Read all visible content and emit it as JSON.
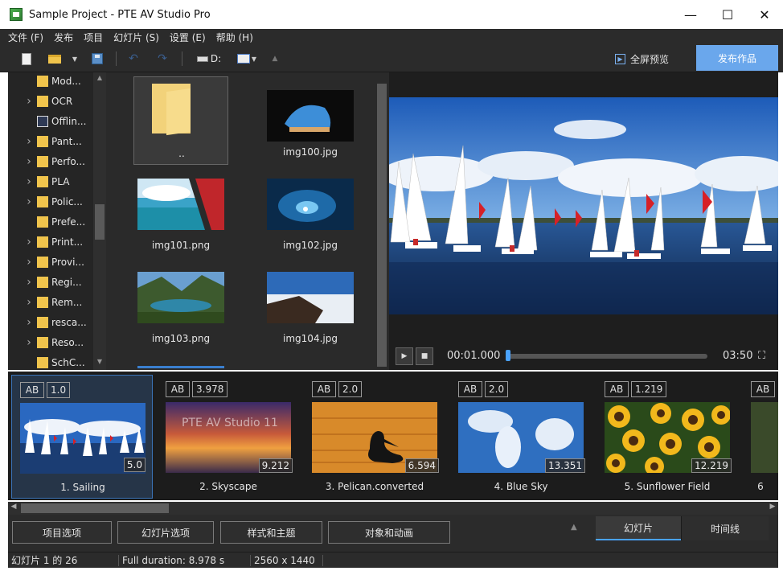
{
  "window": {
    "title": "Sample Project - PTE AV Studio Pro",
    "controls": {
      "minimize": "—",
      "maximize": "☐",
      "close": "✕"
    }
  },
  "menu": [
    "文件 (F)",
    "发布",
    "项目",
    "幻灯片 (S)",
    "设置 (E)",
    "帮助 (H)"
  ],
  "toolbar": {
    "drive_label": "D:",
    "fullscreen_preview": "全屏预览",
    "publish": "发布作品"
  },
  "tree": {
    "items": [
      {
        "label": "Mod...",
        "expandable": false,
        "icon": "folder-icon"
      },
      {
        "label": "OCR",
        "expandable": true,
        "icon": "folder-icon"
      },
      {
        "label": "Offlin...",
        "expandable": false,
        "icon": "special-folder-icon"
      },
      {
        "label": "Pant...",
        "expandable": true,
        "icon": "folder-icon"
      },
      {
        "label": "Perfo...",
        "expandable": true,
        "icon": "folder-icon"
      },
      {
        "label": "PLA",
        "expandable": true,
        "icon": "folder-icon"
      },
      {
        "label": "Polic...",
        "expandable": true,
        "icon": "folder-icon"
      },
      {
        "label": "Prefe...",
        "expandable": false,
        "icon": "folder-icon"
      },
      {
        "label": "Print...",
        "expandable": true,
        "icon": "folder-icon"
      },
      {
        "label": "Provi...",
        "expandable": true,
        "icon": "folder-icon"
      },
      {
        "label": "Regi...",
        "expandable": true,
        "icon": "folder-icon"
      },
      {
        "label": "Rem...",
        "expandable": true,
        "icon": "folder-icon"
      },
      {
        "label": "resca...",
        "expandable": true,
        "icon": "folder-icon"
      },
      {
        "label": "Reso...",
        "expandable": true,
        "icon": "folder-icon"
      },
      {
        "label": "SchC...",
        "expandable": false,
        "icon": "folder-icon"
      }
    ]
  },
  "files": [
    {
      "name": "..",
      "kind": "parent-folder"
    },
    {
      "name": "img100.jpg",
      "kind": "image"
    },
    {
      "name": "img101.png",
      "kind": "image"
    },
    {
      "name": "img102.jpg",
      "kind": "image"
    },
    {
      "name": "img103.png",
      "kind": "image"
    },
    {
      "name": "img104.jpg",
      "kind": "image"
    }
  ],
  "player": {
    "current_time": "00:01.000",
    "total_time": "03:50",
    "progress": 0.004
  },
  "slides": [
    {
      "name": "1. Sailing",
      "ab": "AB",
      "transition": "1.0",
      "duration": "5.0",
      "selected": true
    },
    {
      "name": "2. Skyscape",
      "ab": "AB",
      "transition": "3.978",
      "duration": "9.212",
      "selected": false,
      "overlay_text": "PTE AV Studio 11"
    },
    {
      "name": "3. Pelican.converted",
      "ab": "AB",
      "transition": "2.0",
      "duration": "6.594",
      "selected": false
    },
    {
      "name": "4. Blue Sky",
      "ab": "AB",
      "transition": "2.0",
      "duration": "13.351",
      "selected": false
    },
    {
      "name": "5. Sunflower Field",
      "ab": "AB",
      "transition": "1.219",
      "duration": "12.219",
      "selected": false
    },
    {
      "name": "6",
      "ab": "AB",
      "transition": "",
      "duration": "",
      "selected": false
    }
  ],
  "bottom_buttons": {
    "project_options": "项目选项",
    "slide_options": "幻灯片选项",
    "styles_themes": "样式和主题",
    "objects_animation": "对象和动画"
  },
  "view_tabs": {
    "slides": "幻灯片",
    "timeline": "时间线"
  },
  "status": {
    "slide_position": "幻灯片 1 的 26",
    "full_duration": "Full duration: 8.978 s",
    "resolution": "2560 x 1440"
  },
  "colors": {
    "accent": "#4aa3ff",
    "publish_bg": "#6aa7ec",
    "panel_bg": "#2b2b2b",
    "folder": "#f0c44c"
  }
}
